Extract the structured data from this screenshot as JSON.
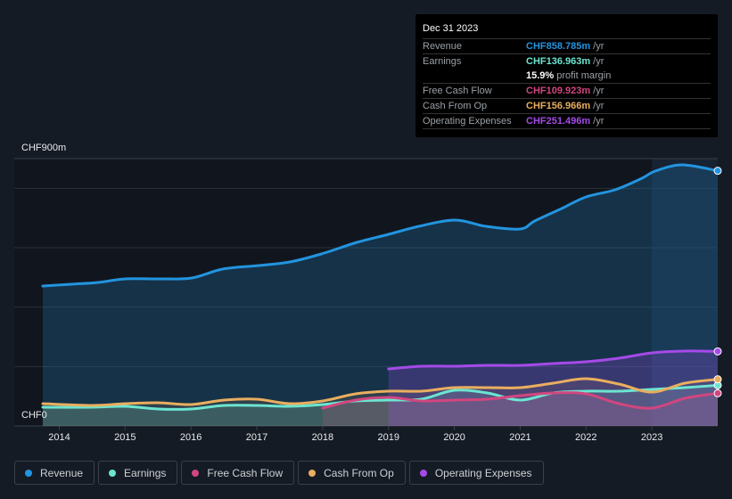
{
  "tooltip": {
    "date": "Dec 31 2023",
    "rows": [
      {
        "label": "Revenue",
        "value": "CHF858.785m",
        "unit": "/yr",
        "color": "#2394df"
      },
      {
        "label": "Earnings",
        "value": "CHF136.963m",
        "unit": "/yr",
        "color": "#6ce5d1"
      },
      {
        "label": "",
        "value": "15.9%",
        "unit": "profit margin",
        "color": "#ffffff"
      },
      {
        "label": "Free Cash Flow",
        "value": "CHF109.923m",
        "unit": "/yr",
        "color": "#d1467f"
      },
      {
        "label": "Cash From Op",
        "value": "CHF156.966m",
        "unit": "/yr",
        "color": "#e9ae5f"
      },
      {
        "label": "Operating Expenses",
        "value": "CHF251.496m",
        "unit": "/yr",
        "color": "#a54ae8"
      }
    ]
  },
  "legend": [
    {
      "label": "Revenue",
      "color": "#2394df"
    },
    {
      "label": "Earnings",
      "color": "#6ce5d1"
    },
    {
      "label": "Free Cash Flow",
      "color": "#d1467f"
    },
    {
      "label": "Cash From Op",
      "color": "#e9ae5f"
    },
    {
      "label": "Operating Expenses",
      "color": "#a54ae8"
    }
  ],
  "chart_data": {
    "type": "area",
    "title": "",
    "xlabel": "",
    "ylabel": "",
    "y_unit": "CHF m",
    "ylim": [
      0,
      900
    ],
    "y_tick_labels": [
      "CHF0",
      "CHF900m"
    ],
    "gridlines": [
      0,
      200,
      400,
      600,
      800,
      900
    ],
    "xlim": [
      2013.75,
      2024.0
    ],
    "x_tick_labels": [
      "2014",
      "2015",
      "2016",
      "2017",
      "2018",
      "2019",
      "2020",
      "2021",
      "2022",
      "2023"
    ],
    "x_ticks": [
      2014,
      2015,
      2016,
      2017,
      2018,
      2019,
      2020,
      2021,
      2022,
      2023
    ],
    "highlight_start": 2023.0,
    "legend_position": "bottom",
    "series": [
      {
        "name": "Revenue",
        "color": "#2394df",
        "x": [
          2013.75,
          2014.18,
          2014.59,
          2015.0,
          2015.53,
          2016.01,
          2016.48,
          2017.03,
          2017.5,
          2017.98,
          2018.52,
          2019.0,
          2019.46,
          2020.01,
          2020.48,
          2021.0,
          2021.22,
          2021.63,
          2022.0,
          2022.44,
          2022.85,
          2023.05,
          2023.46,
          2024.0
        ],
        "y": [
          471,
          477,
          483,
          495,
          495,
          498,
          528,
          540,
          552,
          579,
          618,
          645,
          672,
          693,
          672,
          663,
          690,
          732,
          771,
          795,
          834,
          858,
          879,
          859
        ]
      },
      {
        "name": "Earnings",
        "color": "#6ce5d1",
        "x": [
          2013.75,
          2014.5,
          2015.0,
          2015.5,
          2016.0,
          2016.5,
          2017.0,
          2017.5,
          2018.0,
          2018.5,
          2019.0,
          2019.5,
          2020.0,
          2020.5,
          2021.0,
          2021.5,
          2022.0,
          2022.5,
          2023.0,
          2023.5,
          2024.0
        ],
        "y": [
          63,
          63,
          66,
          57,
          57,
          69,
          69,
          66,
          72,
          84,
          87,
          90,
          120,
          111,
          87,
          111,
          117,
          117,
          123,
          129,
          137
        ]
      },
      {
        "name": "Free Cash Flow",
        "color": "#d1467f",
        "x": [
          2018.0,
          2018.5,
          2019.0,
          2019.5,
          2020.0,
          2020.5,
          2021.0,
          2021.5,
          2022.0,
          2022.5,
          2023.0,
          2023.5,
          2024.0
        ],
        "y": [
          60,
          87,
          96,
          84,
          87,
          90,
          102,
          111,
          108,
          75,
          60,
          93,
          110
        ]
      },
      {
        "name": "Cash From Op",
        "color": "#e9ae5f",
        "x": [
          2013.75,
          2014.5,
          2015.0,
          2015.5,
          2016.0,
          2016.5,
          2017.0,
          2017.5,
          2018.0,
          2018.5,
          2019.0,
          2019.5,
          2020.0,
          2020.5,
          2021.0,
          2021.5,
          2022.0,
          2022.5,
          2023.0,
          2023.5,
          2024.0
        ],
        "y": [
          75,
          69,
          75,
          78,
          72,
          87,
          90,
          75,
          84,
          108,
          117,
          117,
          129,
          129,
          129,
          144,
          159,
          141,
          114,
          144,
          157
        ]
      },
      {
        "name": "Operating Expenses",
        "color": "#a54ae8",
        "x": [
          2019.0,
          2019.5,
          2020.0,
          2020.5,
          2021.0,
          2021.5,
          2022.0,
          2022.5,
          2023.0,
          2023.5,
          2024.0
        ],
        "y": [
          192,
          201,
          201,
          204,
          204,
          210,
          216,
          228,
          246,
          252,
          251
        ]
      }
    ]
  }
}
